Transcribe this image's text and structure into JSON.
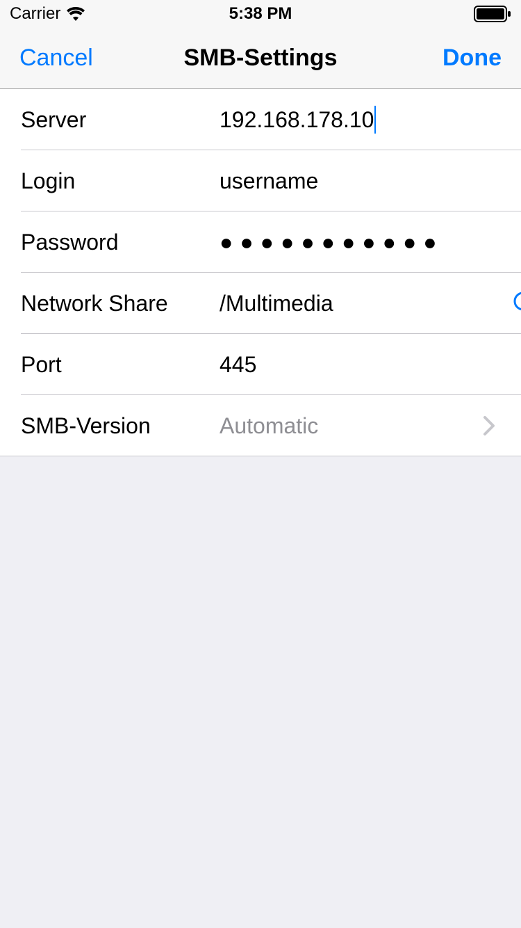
{
  "statusBar": {
    "carrier": "Carrier",
    "time": "5:38 PM"
  },
  "navBar": {
    "cancel": "Cancel",
    "title": "SMB-Settings",
    "done": "Done"
  },
  "form": {
    "server": {
      "label": "Server",
      "value": "192.168.178.10"
    },
    "login": {
      "label": "Login",
      "value": "username"
    },
    "password": {
      "label": "Password",
      "value": "●●●●●●●●●●●"
    },
    "networkShare": {
      "label": "Network Share",
      "value": "/Multimedia"
    },
    "port": {
      "label": "Port",
      "value": "445"
    },
    "smbVersion": {
      "label": "SMB-Version",
      "value": "Automatic"
    }
  },
  "colors": {
    "accent": "#007aff",
    "placeholder": "#8e8e93"
  }
}
